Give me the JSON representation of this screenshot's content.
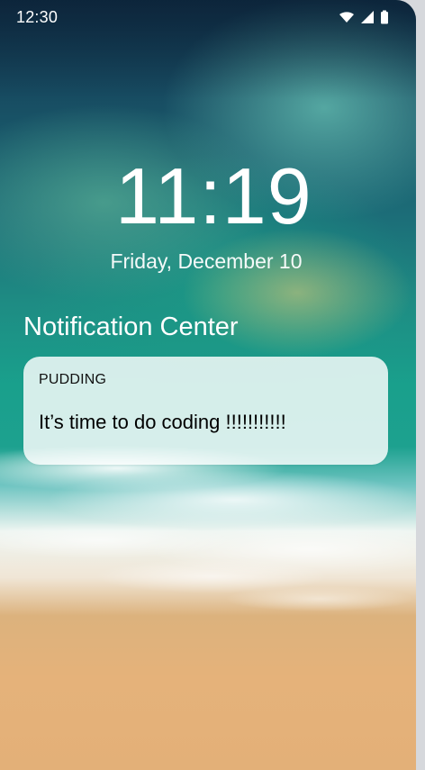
{
  "status_bar": {
    "time": "12:30",
    "icons": [
      "wifi-icon",
      "cellular-signal-icon",
      "battery-icon"
    ]
  },
  "lock_screen": {
    "clock": "11:19",
    "date": "Friday, December 10"
  },
  "notification_center": {
    "title": "Notification Center",
    "notifications": [
      {
        "app": "PUDDING",
        "message": "It’s time to do coding !!!!!!!!!!!"
      }
    ]
  }
}
